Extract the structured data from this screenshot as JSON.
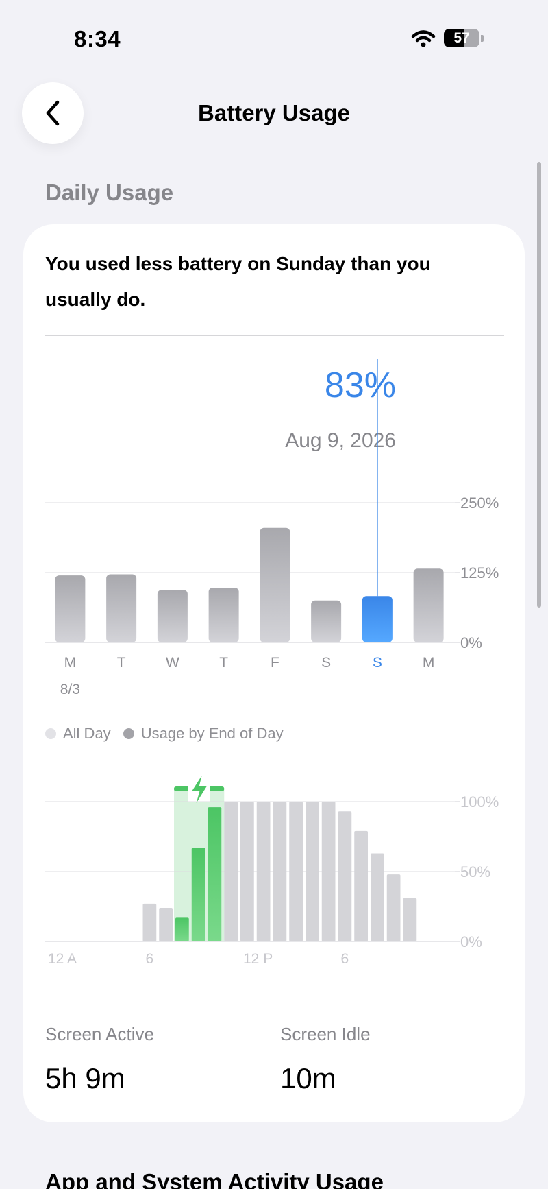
{
  "status_bar": {
    "time": "8:34",
    "battery_percent": 57
  },
  "nav": {
    "title": "Battery Usage"
  },
  "daily": {
    "section_title": "Daily Usage",
    "summary": "You used less battery on Sunday than you usually do.",
    "selected_value": "83%",
    "selected_date": "Aug 9, 2026",
    "legend": {
      "all_day": "All Day",
      "end_of_day": "Usage by End of Day"
    }
  },
  "stats": {
    "screen_active_label": "Screen Active",
    "screen_active_value": "5h 9m",
    "screen_idle_label": "Screen Idle",
    "screen_idle_value": "10m"
  },
  "next_section_title": "App and System Activity Usage",
  "colors": {
    "accent": "#3A86E8",
    "bar_gray": "#B8B8BD",
    "charging_green": "#4CC564"
  },
  "chart_data": [
    {
      "type": "bar",
      "categories": [
        "M",
        "T",
        "W",
        "T",
        "F",
        "S",
        "S",
        "M"
      ],
      "sublabels": [
        "8/3",
        "",
        "",
        "",
        "",
        "",
        "",
        ""
      ],
      "values": [
        120,
        122,
        94,
        98,
        205,
        75,
        83,
        132
      ],
      "selected_index": 6,
      "y_ticks": [
        "0%",
        "125%",
        "250%"
      ],
      "ylim": [
        0,
        250
      ]
    },
    {
      "type": "bar",
      "x_ticks": [
        "12 A",
        "6",
        "12 P",
        "6"
      ],
      "y_ticks": [
        "0%",
        "50%",
        "100%"
      ],
      "ylim": [
        0,
        100
      ],
      "slots": 24,
      "values": [
        null,
        null,
        null,
        null,
        null,
        null,
        27,
        24,
        17,
        67,
        96,
        100,
        100,
        100,
        100,
        100,
        100,
        100,
        93,
        79,
        63,
        48,
        31,
        null
      ],
      "charging_indices": [
        8,
        9,
        10
      ]
    }
  ]
}
